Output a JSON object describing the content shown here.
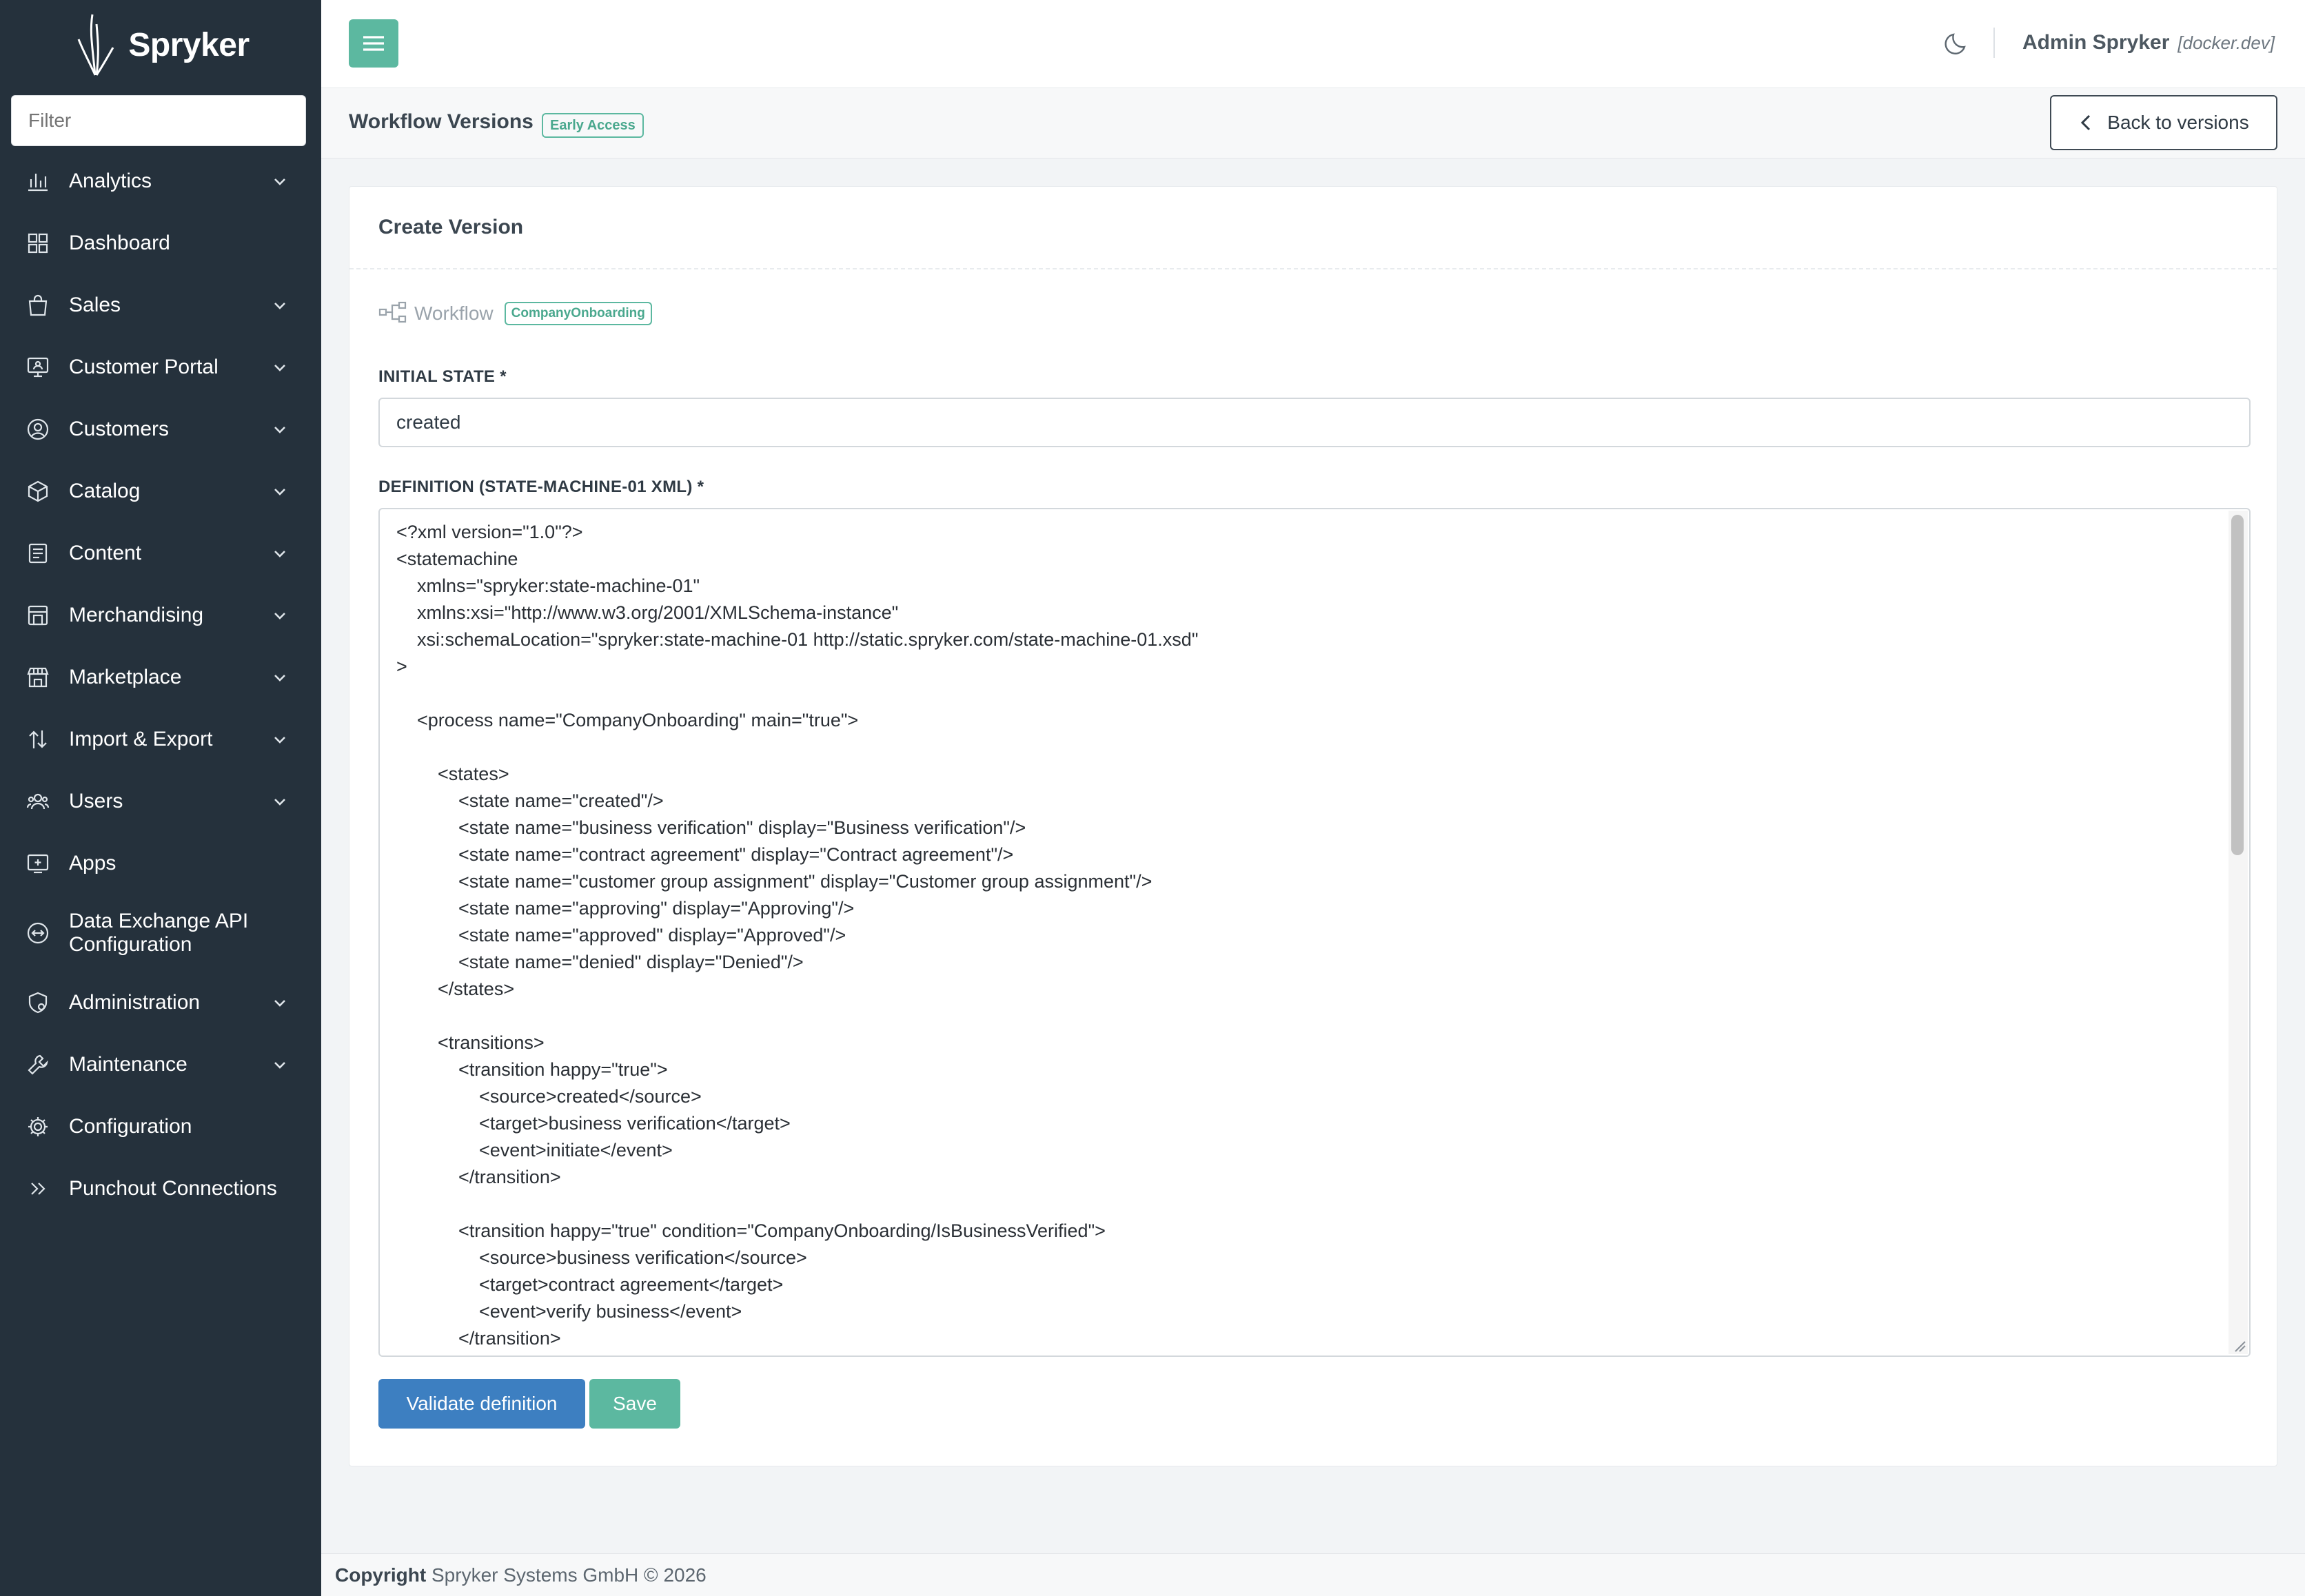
{
  "brand": {
    "name": "Spryker"
  },
  "sidebar": {
    "filter_placeholder": "Filter",
    "items": [
      {
        "label": "Analytics",
        "icon": "chart-bars-icon",
        "expandable": true
      },
      {
        "label": "Dashboard",
        "icon": "grid-icon",
        "expandable": false
      },
      {
        "label": "Sales",
        "icon": "shopping-bag-icon",
        "expandable": true
      },
      {
        "label": "Customer Portal",
        "icon": "monitor-user-icon",
        "expandable": true
      },
      {
        "label": "Customers",
        "icon": "user-circle-icon",
        "expandable": true
      },
      {
        "label": "Catalog",
        "icon": "box-icon",
        "expandable": true
      },
      {
        "label": "Content",
        "icon": "document-icon",
        "expandable": true
      },
      {
        "label": "Merchandising",
        "icon": "store-icon",
        "expandable": true
      },
      {
        "label": "Marketplace",
        "icon": "marketplace-icon",
        "expandable": true
      },
      {
        "label": "Import & Export",
        "icon": "import-export-icon",
        "expandable": true
      },
      {
        "label": "Users",
        "icon": "users-icon",
        "expandable": true
      },
      {
        "label": "Apps",
        "icon": "apps-icon",
        "expandable": false
      },
      {
        "label": "Data Exchange API Configuration",
        "icon": "exchange-icon",
        "expandable": false
      },
      {
        "label": "Administration",
        "icon": "shield-gear-icon",
        "expandable": true
      },
      {
        "label": "Maintenance",
        "icon": "wrench-icon",
        "expandable": true
      },
      {
        "label": "Configuration",
        "icon": "gear-icon",
        "expandable": false
      },
      {
        "label": "Punchout Connections",
        "icon": "double-chevron-right-icon",
        "expandable": false
      }
    ]
  },
  "topbar": {
    "user_name": "Admin Spryker",
    "user_env": "[docker.dev]"
  },
  "page": {
    "title": "Workflow Versions",
    "badge": "Early Access",
    "back_button": "Back to versions"
  },
  "form": {
    "card_title": "Create Version",
    "workflow_label": "Workflow",
    "workflow_name": "CompanyOnboarding",
    "initial_state_label": "INITIAL STATE *",
    "initial_state_value": "created",
    "definition_label": "DEFINITION (STATE-MACHINE-01 XML) *",
    "definition_value": "<?xml version=\"1.0\"?>\n<statemachine\n    xmlns=\"spryker:state-machine-01\"\n    xmlns:xsi=\"http://www.w3.org/2001/XMLSchema-instance\"\n    xsi:schemaLocation=\"spryker:state-machine-01 http://static.spryker.com/state-machine-01.xsd\"\n>\n\n    <process name=\"CompanyOnboarding\" main=\"true\">\n\n        <states>\n            <state name=\"created\"/>\n            <state name=\"business verification\" display=\"Business verification\"/>\n            <state name=\"contract agreement\" display=\"Contract agreement\"/>\n            <state name=\"customer group assignment\" display=\"Customer group assignment\"/>\n            <state name=\"approving\" display=\"Approving\"/>\n            <state name=\"approved\" display=\"Approved\"/>\n            <state name=\"denied\" display=\"Denied\"/>\n        </states>\n\n        <transitions>\n            <transition happy=\"true\">\n                <source>created</source>\n                <target>business verification</target>\n                <event>initiate</event>\n            </transition>\n\n            <transition happy=\"true\" condition=\"CompanyOnboarding/IsBusinessVerified\">\n                <source>business verification</source>\n                <target>contract agreement</target>\n                <event>verify business</event>\n            </transition>",
    "validate_button": "Validate definition",
    "save_button": "Save"
  },
  "footer": {
    "label": "Copyright",
    "text": "Spryker Systems GmbH © 2026"
  },
  "colors": {
    "sidebar_bg": "#25313c",
    "accent_green": "#5cb8a0",
    "primary_blue": "#3d7fc1",
    "page_bg": "#f2f4f6"
  }
}
